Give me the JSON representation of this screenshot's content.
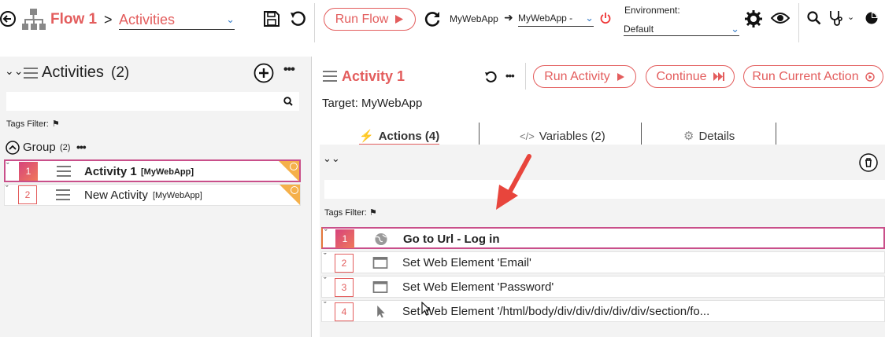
{
  "toolbar": {
    "flow_title": "Flow 1",
    "breadcrumb_sep": ">",
    "section_select": "Activities",
    "run_flow_label": "Run Flow",
    "app_source": "MyWebApp",
    "app_target": "MyWebApp -",
    "environment_label": "Environment:",
    "environment_value": "Default"
  },
  "left": {
    "title": "Activities",
    "count": "(2)",
    "search_placeholder": "",
    "tags_filter_label": "Tags Filter:",
    "group": {
      "label": "Group",
      "count": "(2)"
    },
    "activities": [
      {
        "num": "1",
        "name": "Activity 1",
        "tag": "[MyWebApp]",
        "selected": true
      },
      {
        "num": "2",
        "name": "New Activity",
        "tag": "[MyWebApp]",
        "selected": false
      }
    ]
  },
  "right": {
    "activity_title": "Activity 1",
    "run_activity_label": "Run Activity",
    "continue_label": "Continue",
    "run_current_action_label": "Run Current Action",
    "target_label": "Target: MyWebApp",
    "tabs": [
      {
        "label": "Actions (4)",
        "active": true
      },
      {
        "label": "Variables (2)",
        "active": false
      },
      {
        "label": "Details",
        "active": false
      }
    ],
    "tags_filter_label": "Tags Filter:",
    "actions": [
      {
        "num": "1",
        "label": "Go to Url - Log in",
        "icon": "globe-icon",
        "selected": true
      },
      {
        "num": "2",
        "label": "Set Web Element 'Email'",
        "icon": "window-icon",
        "selected": false
      },
      {
        "num": "3",
        "label": "Set Web Element 'Password'",
        "icon": "window-icon",
        "selected": false
      },
      {
        "num": "4",
        "label": "Set Web Element '/html/body/div/div/div/div/div/section/fo...",
        "icon": "pointer-icon",
        "selected": false
      }
    ]
  },
  "colors": {
    "accent": "#e35d5d",
    "selection_border": "#c94f8a",
    "pane_bg": "#f3f3f3",
    "corner_badge": "#f5b04a",
    "arrow": "#e8453c"
  }
}
